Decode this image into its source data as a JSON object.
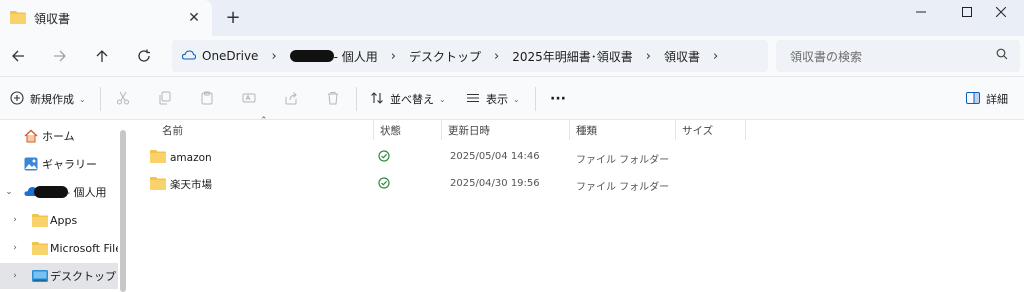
{
  "tab": {
    "title": "領収書",
    "close": "✕",
    "new": "+"
  },
  "window": {
    "minimize": "—",
    "maximize": "☐",
    "close": "✕"
  },
  "breadcrumbs": [
    {
      "label": "OneDrive"
    },
    {
      "label": "- 個人用",
      "redacted": true
    },
    {
      "label": "デスクトップ"
    },
    {
      "label": "2025年明細書･領収書"
    },
    {
      "label": "領収書"
    }
  ],
  "search": {
    "placeholder": "領収書の検索"
  },
  "toolbar": {
    "new_label": "新規作成",
    "sort_label": "並べ替え",
    "view_label": "表示",
    "more_label": "···",
    "details_label": "詳細"
  },
  "sidebar": {
    "items": [
      {
        "label": "ホーム",
        "icon": "home-icon",
        "indent": 0,
        "expander": ""
      },
      {
        "label": "ギャラリー",
        "icon": "gallery-icon",
        "indent": 0,
        "expander": ""
      },
      {
        "label": "- 個人用",
        "icon": "onedrive-cloud-icon",
        "indent": 0,
        "expander": "⌄",
        "redacted": true
      },
      {
        "label": "Apps",
        "icon": "folder-icon",
        "indent": 1,
        "expander": "›"
      },
      {
        "label": "Microsoft File",
        "icon": "folder-icon",
        "indent": 1,
        "expander": "›"
      },
      {
        "label": "デスクトップ",
        "icon": "desktop-icon",
        "indent": 1,
        "expander": "›",
        "selected": true
      }
    ]
  },
  "columns": [
    "名前",
    "状態",
    "更新日時",
    "種類",
    "サイズ"
  ],
  "files": [
    {
      "name": "amazon",
      "status": "synced",
      "modified": "2025/05/04 14:46",
      "type": "ファイル フォルダー"
    },
    {
      "name": "楽天市場",
      "status": "synced",
      "modified": "2025/04/30 19:56",
      "type": "ファイル フォルダー"
    }
  ],
  "colors": {
    "folder": "#f4c34a",
    "synced": "#2e8b3e",
    "accent": "#0a5ec2"
  }
}
